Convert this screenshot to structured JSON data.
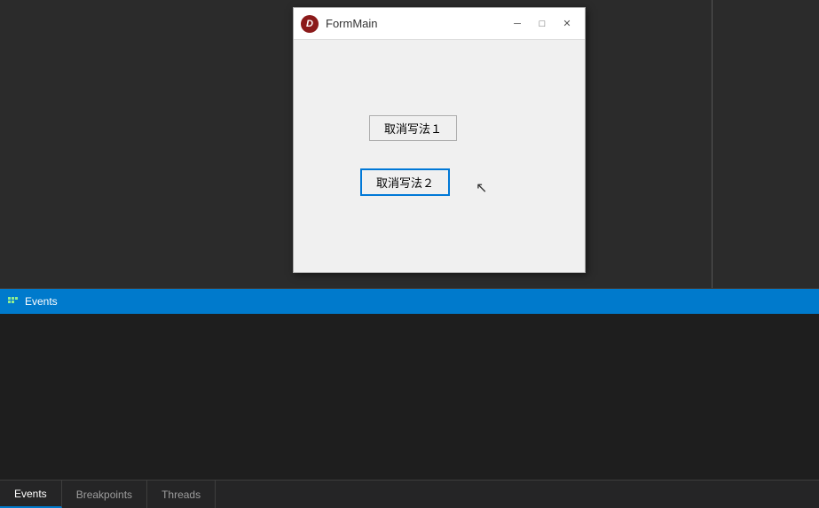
{
  "ide": {
    "background_color": "#2b2b2b"
  },
  "form_window": {
    "title": "FormMain",
    "icon_label": "D",
    "controls": {
      "minimize": "─",
      "maximize": "□",
      "close": "✕"
    },
    "buttons": [
      {
        "id": "btn1",
        "label": "取消写法１"
      },
      {
        "id": "btn2",
        "label": "取消写法２"
      }
    ]
  },
  "bottom_panel": {
    "header": {
      "icon": "⚡",
      "title": "Events"
    },
    "tabs": [
      {
        "id": "events",
        "label": "Events",
        "active": true
      },
      {
        "id": "breakpoints",
        "label": "Breakpoints",
        "active": false
      },
      {
        "id": "threads",
        "label": "Threads",
        "active": false
      }
    ]
  }
}
